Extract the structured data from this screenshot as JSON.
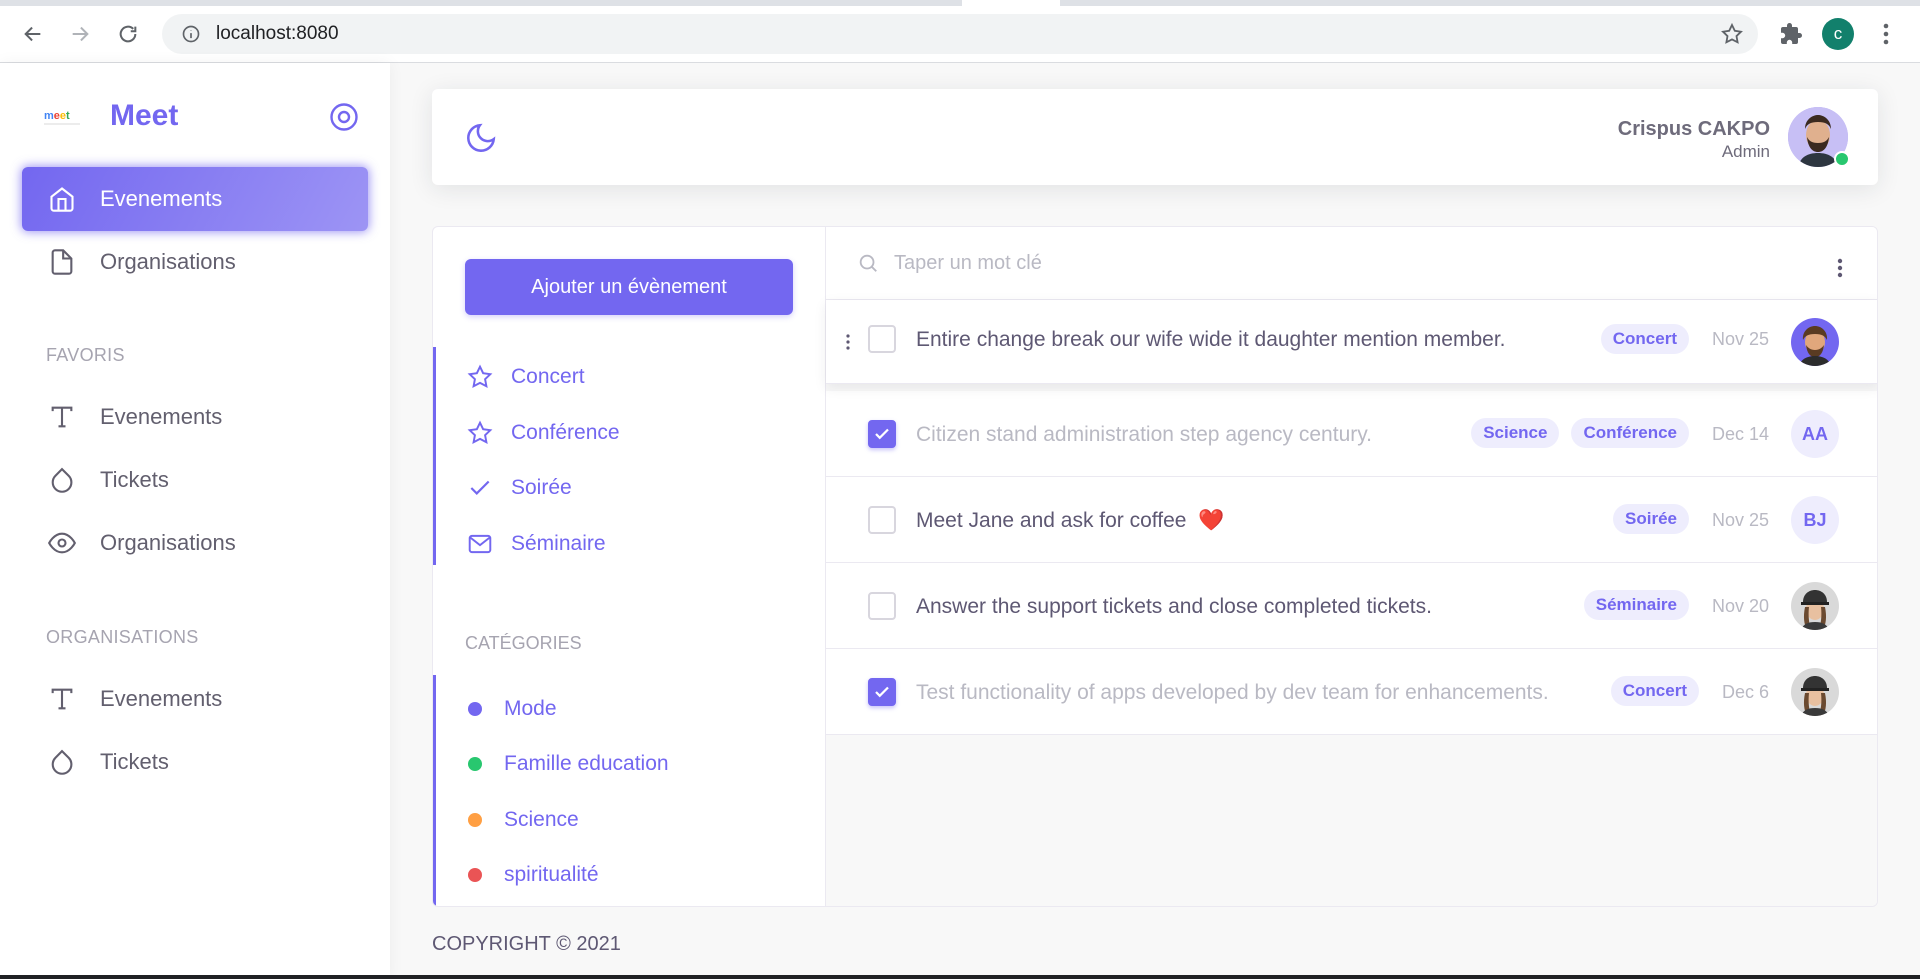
{
  "browser": {
    "url": "localhost:8080",
    "profile_initial": "c"
  },
  "sidebar": {
    "brand_logo": "meet",
    "brand_name": "Meet",
    "items": [
      {
        "label": "Evenements",
        "icon": "home-icon",
        "active": true
      },
      {
        "label": "Organisations",
        "icon": "file-icon",
        "active": false
      }
    ],
    "favoris_header": "FAVORIS",
    "favoris": [
      {
        "label": "Evenements",
        "icon": "type-icon"
      },
      {
        "label": "Tickets",
        "icon": "droplet-icon"
      },
      {
        "label": "Organisations",
        "icon": "eye-icon"
      }
    ],
    "organisations_header": "ORGANISATIONS",
    "organisations": [
      {
        "label": "Evenements",
        "icon": "type-icon"
      },
      {
        "label": "Tickets",
        "icon": "droplet-icon"
      }
    ]
  },
  "navbar": {
    "user_name": "Crispus CAKPO",
    "user_role": "Admin"
  },
  "app": {
    "add_button": "Ajouter un évènement",
    "filters": [
      {
        "label": "Concert",
        "icon": "star-icon"
      },
      {
        "label": "Conférence",
        "icon": "star-icon"
      },
      {
        "label": "Soirée",
        "icon": "check-icon"
      },
      {
        "label": "Séminaire",
        "icon": "mail-icon"
      }
    ],
    "categories_header": "CATÉGORIES",
    "categories": [
      {
        "label": "Mode",
        "color": "#7367f0"
      },
      {
        "label": "Famille education",
        "color": "#28c76f"
      },
      {
        "label": "Science",
        "color": "#ff9f43"
      },
      {
        "label": "spiritualité",
        "color": "#ea5455"
      }
    ],
    "search_placeholder": "Taper un mot clé",
    "tasks": [
      {
        "title": "Entire change break our wife wide it daughter mention member.",
        "tags": [
          "Concert"
        ],
        "date": "Nov 25",
        "checked": false,
        "avatar": "photo-man-beard",
        "initials": ""
      },
      {
        "title": "Citizen stand administration step agency century.",
        "tags": [
          "Science",
          "Conférence"
        ],
        "date": "Dec 14",
        "checked": true,
        "avatar": "initials",
        "initials": "AA"
      },
      {
        "title": "Meet Jane and ask for coffee",
        "emoji": "❤️",
        "tags": [
          "Soirée"
        ],
        "date": "Nov 25",
        "checked": false,
        "avatar": "initials",
        "initials": "BJ"
      },
      {
        "title": "Answer the support tickets and close completed tickets.",
        "tags": [
          "Séminaire"
        ],
        "date": "Nov 20",
        "checked": false,
        "avatar": "photo-woman-cap",
        "initials": ""
      },
      {
        "title": "Test functionality of apps developed by dev team for enhancements.",
        "tags": [
          "Concert"
        ],
        "date": "Dec 6",
        "checked": true,
        "avatar": "photo-woman-cap",
        "initials": ""
      }
    ]
  },
  "footer": {
    "copyright": "COPYRIGHT © 2021"
  },
  "colors": {
    "primary": "#7367f0",
    "success": "#28c76f",
    "warning": "#ff9f43",
    "danger": "#ea5455"
  }
}
